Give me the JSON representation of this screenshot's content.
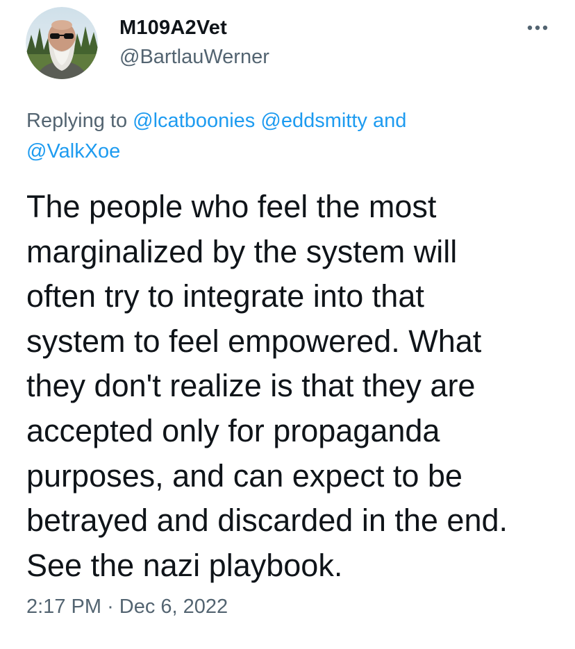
{
  "author": {
    "display_name": "M109A2Vet",
    "handle": "@BartlauWerner",
    "avatar_icon": "bearded-man-sunglasses-avatar"
  },
  "more_icon": "more-horizontal-icon",
  "reply_context": {
    "prefix": "Replying to",
    "mention_1": "@lcatboonies",
    "mention_2": "@eddsmitty",
    "conjunction": "and",
    "mention_3": "@ValkXoe"
  },
  "tweet": {
    "lines": [
      "The people who feel the most",
      "marginalized by the system will",
      "often try to integrate into that",
      "system to feel empowered. What",
      "they don't realize is that they are",
      "accepted only for propaganda",
      "purposes, and can expect to be",
      "betrayed and discarded in the end.",
      "See the nazi playbook."
    ]
  },
  "meta": {
    "time": "2:17 PM",
    "separator": "·",
    "date": "Dec 6, 2022"
  },
  "colors": {
    "text": "#0f1419",
    "secondary": "#536471",
    "link": "#1d9bf0"
  }
}
